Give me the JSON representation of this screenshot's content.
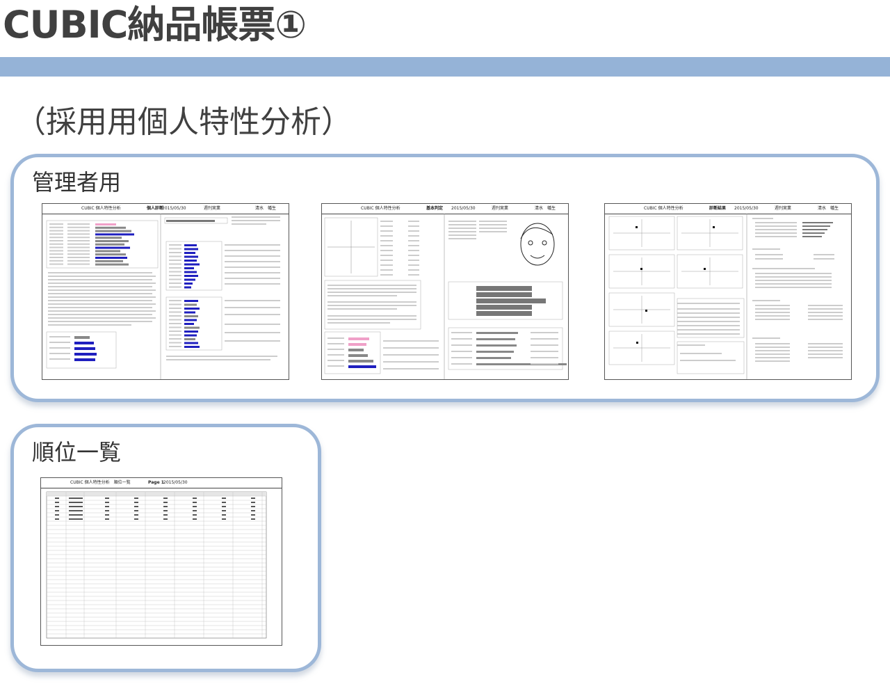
{
  "header": {
    "title": "CUBIC納品帳票①",
    "subtitle": "（採用用個人特性分析）"
  },
  "admin_section": {
    "label": "管理者用",
    "pages": [
      {
        "report": "CUBIC 個人特性分析",
        "kind": "個人診断",
        "date": "2015/05/30",
        "company": "週刊実業",
        "person": "清水　幡生"
      },
      {
        "report": "CUBIC 個人特性分析",
        "kind": "基本判定",
        "date": "2015/05/30",
        "company": "週刊実業",
        "person": "清水　幡生"
      },
      {
        "report": "CUBIC 個人特性分析",
        "kind": "診断結果",
        "date": "2015/05/30",
        "company": "週刊実業",
        "person": "清水　幡生"
      }
    ]
  },
  "ranking_section": {
    "label": "順位一覧",
    "page": {
      "report": "CUBIC 個人特性分析　順位一覧",
      "page_no": "Page 1",
      "date": "2015/05/30"
    }
  },
  "colors": {
    "band": "#95b3d7",
    "panel_border": "#9db7d8",
    "bar_blue": "#1f1fbf",
    "bar_gray": "#888888",
    "bar_pink": "#f0a0c8"
  }
}
